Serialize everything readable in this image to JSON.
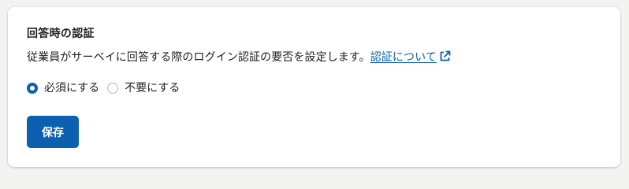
{
  "section": {
    "title": "回答時の認証",
    "description": "従業員がサーベイに回答する際のログイン認証の要否を設定します。",
    "link_label": "認証について",
    "link_icon": "external-link-icon"
  },
  "auth_options": {
    "selected": "required",
    "options": [
      {
        "id": "required",
        "label": "必須にする",
        "checked": true
      },
      {
        "id": "not_required",
        "label": "不要にする",
        "checked": false
      }
    ]
  },
  "actions": {
    "save_label": "保存"
  },
  "colors": {
    "accent": "#0b60b0",
    "text": "#222222",
    "background": "#f3f3f2",
    "card": "#ffffff"
  }
}
